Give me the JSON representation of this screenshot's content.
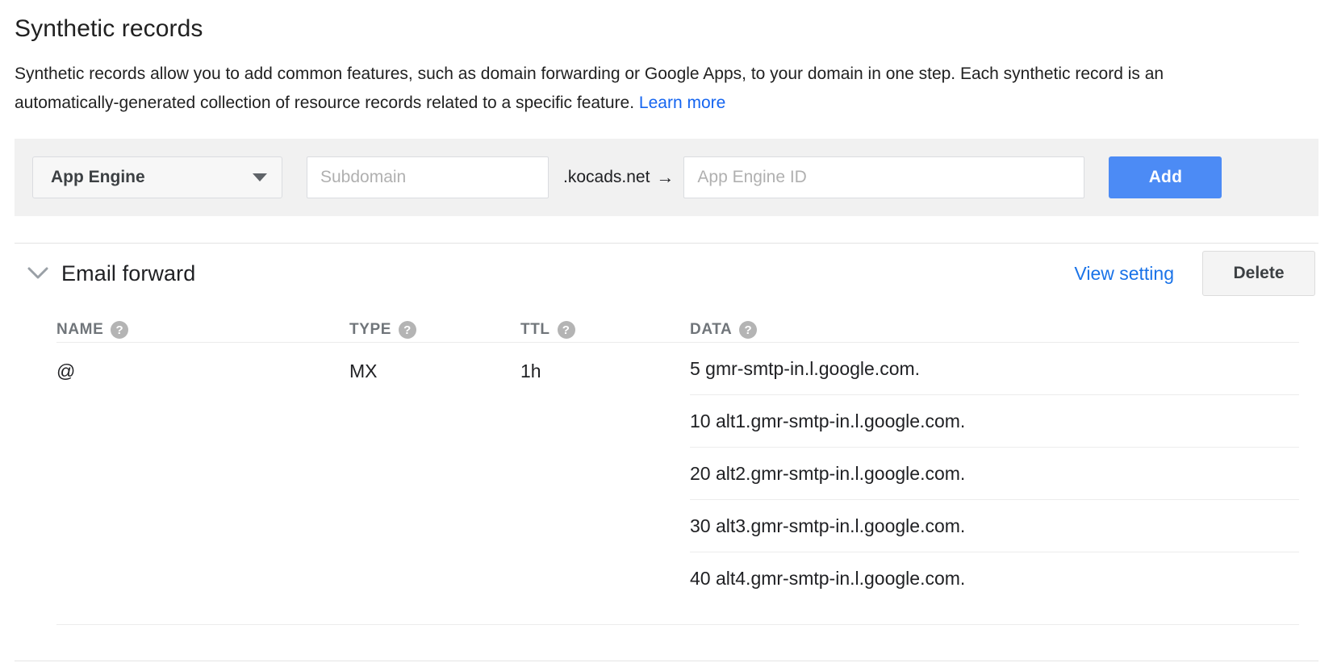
{
  "section": {
    "title": "Synthetic records",
    "description_part1": "Synthetic records allow you to add common features, such as domain forwarding or Google Apps, to your domain in one step. Each synthetic record is an automatically-generated collection of resource records related to a specific feature.",
    "learn_more_label": "Learn more"
  },
  "add_bar": {
    "record_type_selected": "App Engine",
    "caret_icon": "chevron-down-icon",
    "subdomain_placeholder": "Subdomain",
    "domain_suffix": ".kocads.net",
    "arrow_glyph": "→",
    "app_engine_id_placeholder": "App Engine ID",
    "add_label": "Add",
    "add_button_color": "#4c8bf5"
  },
  "record_group": {
    "expand_icon": "chevron-down-icon",
    "title": "Email forward",
    "view_setting_label": "View setting",
    "view_setting_color": "#1a73e8",
    "delete_label": "Delete",
    "columns": [
      {
        "label": "NAME",
        "help_icon": "help-circle-icon"
      },
      {
        "label": "TYPE",
        "help_icon": "help-circle-icon"
      },
      {
        "label": "TTL",
        "help_icon": "help-circle-icon"
      },
      {
        "label": "DATA",
        "help_icon": "help-circle-icon"
      }
    ],
    "record": {
      "name": "@",
      "type": "MX",
      "ttl": "1h",
      "data": [
        "5 gmr-smtp-in.l.google.com.",
        "10 alt1.gmr-smtp-in.l.google.com.",
        "20 alt2.gmr-smtp-in.l.google.com.",
        "30 alt3.gmr-smtp-in.l.google.com.",
        "40 alt4.gmr-smtp-in.l.google.com."
      ]
    }
  }
}
